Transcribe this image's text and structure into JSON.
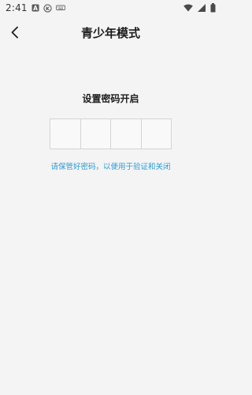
{
  "status_bar": {
    "time": "2:41",
    "icons": [
      "a-badge-icon",
      "k-circle-icon",
      "keyboard-icon",
      "wifi-icon",
      "signal-icon",
      "battery-icon"
    ]
  },
  "header": {
    "back_icon": "chevron-left-icon",
    "title": "青少年模式"
  },
  "main": {
    "prompt": "设置密码开启",
    "code_box_count": 4,
    "hint": "请保管好密码，以便用于验证和关闭"
  },
  "colors": {
    "background": "#f4f4f4",
    "hint": "#2a9ad6",
    "box_border": "#d4d4d4"
  }
}
